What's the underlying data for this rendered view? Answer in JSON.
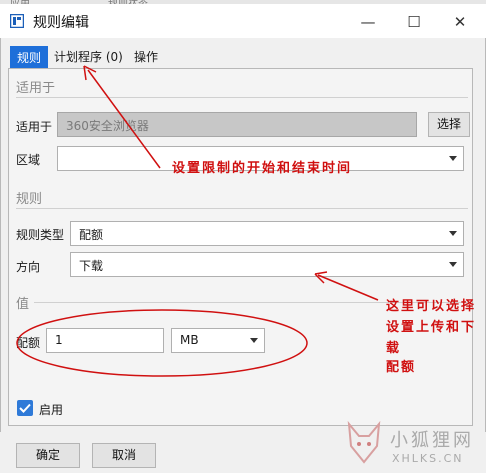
{
  "background_window": {
    "tab_left": "应用…",
    "tab_right": "规则状态…"
  },
  "window": {
    "title": "规则编辑",
    "minimize": "—",
    "maximize": "☐",
    "close": "✕"
  },
  "tabs": [
    {
      "label": "规则",
      "active": true
    },
    {
      "label": "计划程序 (0)",
      "active": false
    },
    {
      "label": "操作",
      "active": false
    }
  ],
  "applies_section": {
    "header": "适用于",
    "applies_label": "适用于",
    "applies_value": "360安全浏览器",
    "choose_button": "选择",
    "zone_label": "区域",
    "zone_value": ""
  },
  "rule_section": {
    "header": "规则",
    "type_label": "规则类型",
    "type_value": "配额",
    "direction_label": "方向",
    "direction_value": "下载"
  },
  "value_section": {
    "header": "值",
    "quota_label": "配额",
    "quota_value": "1",
    "unit_value": "MB"
  },
  "enable": {
    "label": "启用",
    "checked": true
  },
  "footer": {
    "ok": "确定",
    "cancel": "取消"
  },
  "annotations": {
    "note1": "设置限制的开始和结束时间",
    "note2_line1": "这里可以选择",
    "note2_line2": "设置上传和下",
    "note2_line3": "载",
    "note2_line4": "配额"
  },
  "watermark": {
    "text_cn": "小狐狸网",
    "text_en": "XHLKS.CN"
  },
  "colors": {
    "accent": "#1e6fd9",
    "annotation": "#d01010"
  }
}
